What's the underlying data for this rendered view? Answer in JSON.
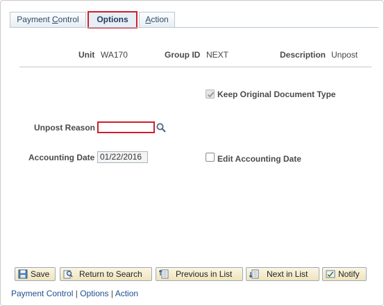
{
  "tabs": [
    {
      "label": "Payment Control",
      "underline_char": "C",
      "active": false
    },
    {
      "label": "Options",
      "active": true
    },
    {
      "label": "Action",
      "underline_char": "A",
      "active": false
    }
  ],
  "header": {
    "unit_label": "Unit",
    "unit_value": "WA170",
    "group_label": "Group ID",
    "group_value": "NEXT",
    "desc_label": "Description",
    "desc_value": "Unpost"
  },
  "form": {
    "keep_original_label": "Keep Original Document Type",
    "keep_original_checked": true,
    "unpost_reason_label": "Unpost Reason",
    "unpost_reason_value": "",
    "accounting_date_label": "Accounting Date",
    "accounting_date_value": "01/22/2016",
    "edit_accounting_date_label": "Edit Accounting Date",
    "edit_accounting_date_checked": false
  },
  "buttons": {
    "save": "Save",
    "return_to_search": "Return to Search",
    "previous_in_list": "Previous in List",
    "next_in_list": "Next in List",
    "notify": "Notify"
  },
  "footer_links": {
    "payment_control": "Payment Control",
    "options": "Options",
    "action": "Action",
    "separator": "|"
  },
  "colors": {
    "highlight": "#cc1f2b",
    "link": "#1c4e8c",
    "button_bg": "#efe4bd"
  },
  "icons": [
    "lookup-search-icon",
    "save-icon",
    "return-to-search-icon",
    "previous-in-list-icon",
    "next-in-list-icon",
    "notify-icon"
  ]
}
